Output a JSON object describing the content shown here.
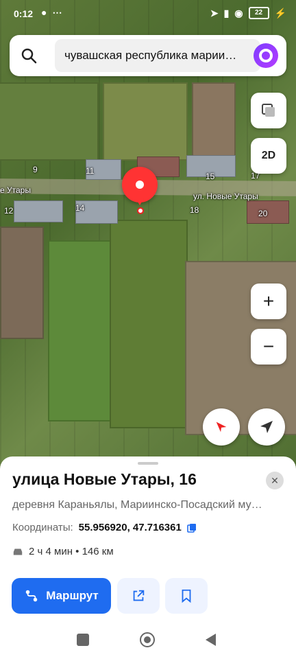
{
  "status_bar": {
    "time": "0:12",
    "battery": "22"
  },
  "search": {
    "query": "чувашская республика марии…"
  },
  "map": {
    "view_mode": "2D",
    "street_name": "ул. Новые Утары",
    "street_name_left": "е Утары",
    "house_numbers": [
      "9",
      "11",
      "12",
      "14",
      "15",
      "17",
      "18",
      "20"
    ],
    "zoom_in": "+",
    "zoom_out": "−"
  },
  "place": {
    "title": "улица Новые Утары, 16",
    "address": "деревня Караньялы, Мариинско-Посадский му…",
    "coords_label": "Координаты:",
    "coords_value": "55.956920, 47.716361",
    "route_info": "2 ч 4 мин • 146 км",
    "route_button": "Маршрут"
  },
  "icons": {
    "search": "search-icon",
    "alice": "alice-icon",
    "layers": "layers-icon",
    "compass": "compass-icon",
    "locate": "locate-icon",
    "copy": "copy-icon",
    "car": "car-icon",
    "share": "share-icon",
    "bookmark": "bookmark-icon"
  },
  "colors": {
    "accent": "#1f6cf0",
    "pin": "#ff3333"
  }
}
